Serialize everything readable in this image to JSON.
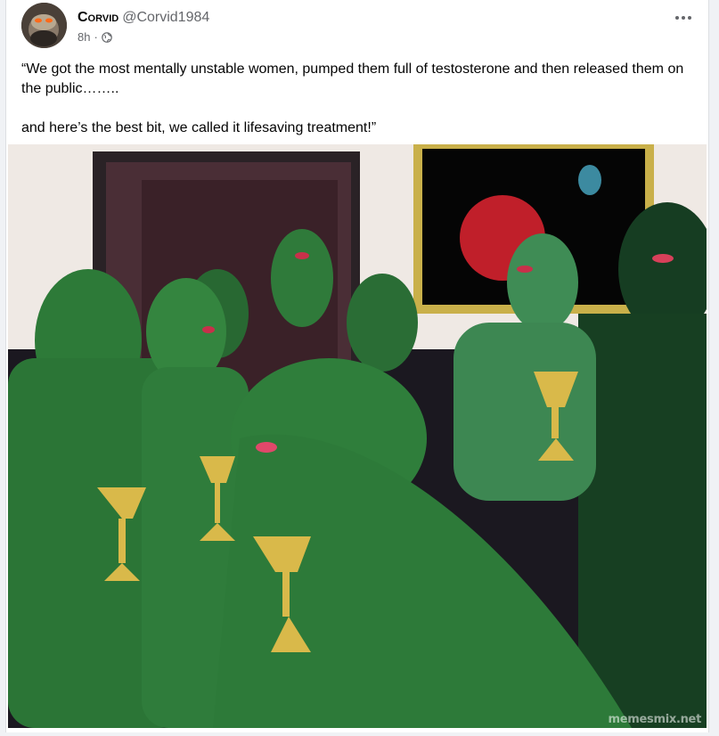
{
  "post": {
    "author_name": "Corvid",
    "author_handle": "@Corvid1984",
    "timestamp": "8h",
    "separator": "·",
    "privacy_icon": "globe-icon",
    "more_icon": "more-horizontal-icon",
    "text_line_1": "“We got the most mentally unstable women, pumped them full of testosterone and then released them on the public……..",
    "text_line_2": "and here’s the best bit, we called it lifesaving treatment!”",
    "image_watermark": "memesmix.net"
  },
  "colors": {
    "background": "#f0f2f5",
    "card": "#ffffff",
    "secondary_text": "#65676b",
    "lizard_green": "#2e7a3a",
    "goblet_yellow": "#d9b94a"
  }
}
